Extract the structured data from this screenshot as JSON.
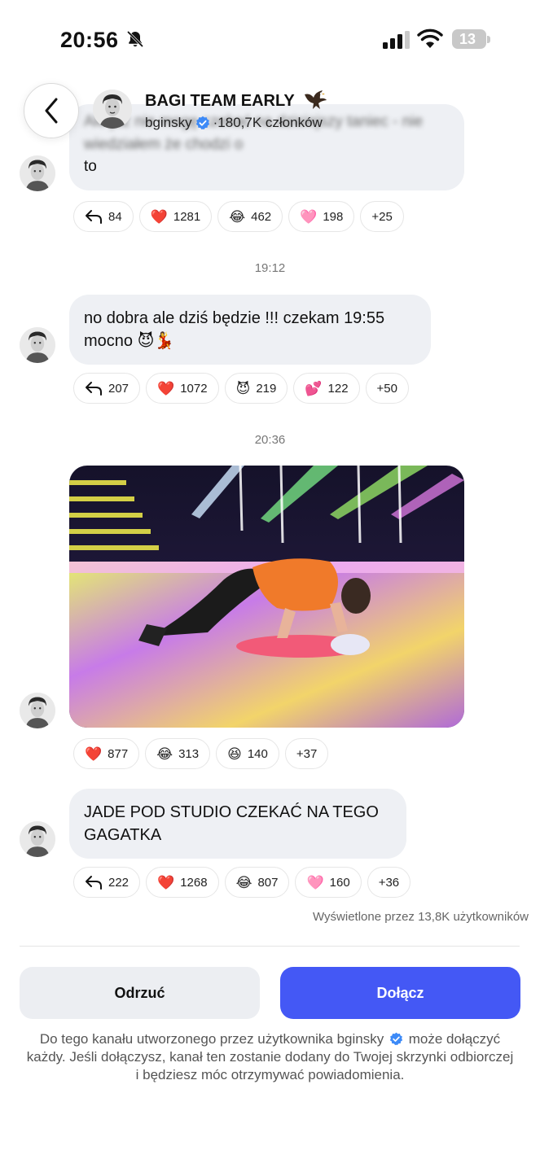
{
  "status_bar": {
    "time": "20:56",
    "battery": "13"
  },
  "header": {
    "title": "BAGI TEAM EARLY",
    "username": "bginsky",
    "members": "·180,7K członków"
  },
  "messages": {
    "m1": {
      "blurred_text": "Ale już nie mogę czekać na dzisiejszy taniec - nie wiedziałem że chodzi o",
      "last_line": "to",
      "reactions": [
        {
          "type": "reply",
          "count": "84"
        },
        {
          "emoji": "❤️",
          "count": "1281"
        },
        {
          "emoji": "😂",
          "count": "462"
        },
        {
          "emoji": "🩷",
          "count": "198"
        },
        {
          "count": "+25"
        }
      ]
    },
    "t1": "19:12",
    "m2": {
      "line1": "no dobra ale dziś będzie !!! czekam 19:55",
      "line2": "mocno 😈💃",
      "reactions": [
        {
          "type": "reply",
          "count": "207"
        },
        {
          "emoji": "❤️",
          "count": "1072"
        },
        {
          "emoji": "😈",
          "count": "219"
        },
        {
          "emoji": "💕",
          "count": "122"
        },
        {
          "count": "+50"
        }
      ]
    },
    "t2": "20:36",
    "m3": {
      "reactions": [
        {
          "emoji": "❤️",
          "count": "877"
        },
        {
          "emoji": "😂",
          "count": "313"
        },
        {
          "emoji": "😆",
          "count": "140"
        },
        {
          "count": "+37"
        }
      ]
    },
    "m4": {
      "line1": "JADE POD STUDIO CZEKAĆ NA TEGO",
      "line2": "GAGATKA",
      "reactions": [
        {
          "type": "reply",
          "count": "222"
        },
        {
          "emoji": "❤️",
          "count": "1268"
        },
        {
          "emoji": "😂",
          "count": "807"
        },
        {
          "emoji": "🩷",
          "count": "160"
        },
        {
          "count": "+36"
        }
      ]
    }
  },
  "viewed": "Wyświetlone przez 13,8K użytkowników",
  "actions": {
    "reject": "Odrzuć",
    "join": "Dołącz"
  },
  "info": {
    "part1": "Do tego kanału utworzonego przez użytkownika bginsky",
    "part2": "może dołączyć każdy. Jeśli dołączysz, kanał ten zostanie dodany do Twojej skrzynki odbiorczej i będziesz móc otrzymywać powiadomienia."
  }
}
